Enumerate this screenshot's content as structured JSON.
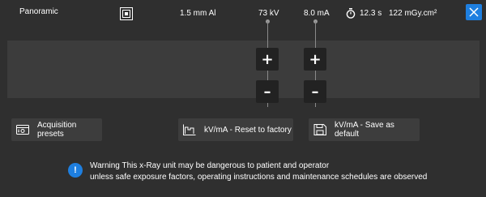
{
  "header": {
    "mode": "Panoramic",
    "filtration": "1.5 mm Al",
    "kv": "73 kV",
    "ma": "8.0 mA",
    "time": "12.3 s",
    "dose": "122 mGy.cm²"
  },
  "icons": {
    "collimator": "collimator-icon",
    "timer": "stopwatch-icon",
    "close": "close-icon",
    "presets": "presets-icon",
    "reset": "chart-reset-icon",
    "save": "save-icon",
    "warning": "info-icon"
  },
  "steppers": {
    "kv_increase": "+",
    "kv_decrease": "–",
    "ma_increase": "+",
    "ma_decrease": "–"
  },
  "actions": {
    "presets_label": "Acquisition presets",
    "reset_label": "kV/mA - Reset to factory",
    "save_label": "kV/mA - Save as default"
  },
  "warning": {
    "icon_glyph": "!",
    "line1": "Warning This x-Ray unit may be dangerous to patient and operator",
    "line2": "unless safe exposure factors, operating instructions and maintenance schedules are observed"
  },
  "colors": {
    "background": "#2f2f2f",
    "panel": "#3c3c3c",
    "accent": "#1e7fe0",
    "stepper": "#222222"
  }
}
